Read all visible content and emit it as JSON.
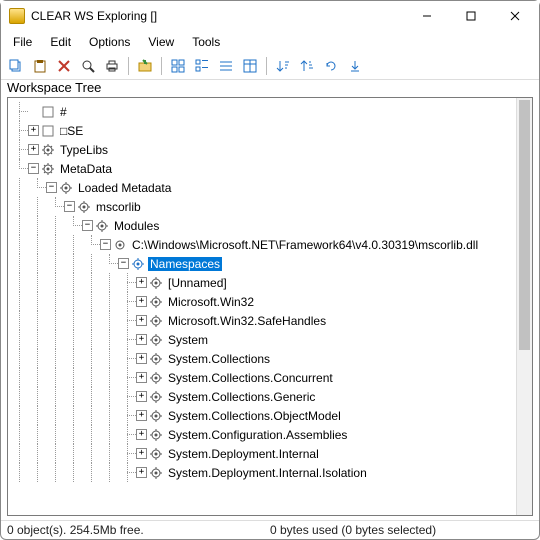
{
  "window": {
    "title": "CLEAR WS Exploring []"
  },
  "menu": {
    "file": "File",
    "edit": "Edit",
    "options": "Options",
    "view": "View",
    "tools": "Tools"
  },
  "panel": {
    "header": "Workspace Tree"
  },
  "tree": {
    "n0": "#",
    "n1": "□SE",
    "n2": "TypeLibs",
    "n3": "MetaData",
    "n4": "Loaded Metadata",
    "n5": "mscorlib",
    "n6": "Modules",
    "n7": "C:\\Windows\\Microsoft.NET\\Framework64\\v4.0.30319\\mscorlib.dll",
    "n8": "Namespaces",
    "n9": "[Unnamed]",
    "n10": "Microsoft.Win32",
    "n11": "Microsoft.Win32.SafeHandles",
    "n12": "System",
    "n13": "System.Collections",
    "n14": "System.Collections.Concurrent",
    "n15": "System.Collections.Generic",
    "n16": "System.Collections.ObjectModel",
    "n17": "System.Configuration.Assemblies",
    "n18": "System.Deployment.Internal",
    "n19": "System.Deployment.Internal.Isolation"
  },
  "status": {
    "left": "0 object(s). 254.5Mb free.",
    "right": "0 bytes used (0 bytes selected)"
  }
}
